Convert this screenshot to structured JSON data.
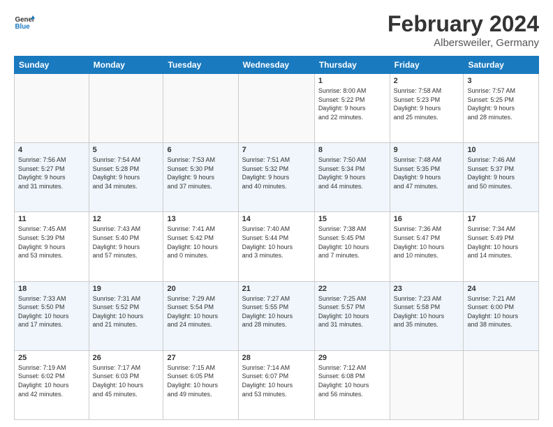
{
  "header": {
    "logo_line1": "General",
    "logo_line2": "Blue",
    "month_year": "February 2024",
    "location": "Albersweiler, Germany"
  },
  "days_of_week": [
    "Sunday",
    "Monday",
    "Tuesday",
    "Wednesday",
    "Thursday",
    "Friday",
    "Saturday"
  ],
  "weeks": [
    [
      {
        "day": "",
        "info": ""
      },
      {
        "day": "",
        "info": ""
      },
      {
        "day": "",
        "info": ""
      },
      {
        "day": "",
        "info": ""
      },
      {
        "day": "1",
        "info": "Sunrise: 8:00 AM\nSunset: 5:22 PM\nDaylight: 9 hours\nand 22 minutes."
      },
      {
        "day": "2",
        "info": "Sunrise: 7:58 AM\nSunset: 5:23 PM\nDaylight: 9 hours\nand 25 minutes."
      },
      {
        "day": "3",
        "info": "Sunrise: 7:57 AM\nSunset: 5:25 PM\nDaylight: 9 hours\nand 28 minutes."
      }
    ],
    [
      {
        "day": "4",
        "info": "Sunrise: 7:56 AM\nSunset: 5:27 PM\nDaylight: 9 hours\nand 31 minutes."
      },
      {
        "day": "5",
        "info": "Sunrise: 7:54 AM\nSunset: 5:28 PM\nDaylight: 9 hours\nand 34 minutes."
      },
      {
        "day": "6",
        "info": "Sunrise: 7:53 AM\nSunset: 5:30 PM\nDaylight: 9 hours\nand 37 minutes."
      },
      {
        "day": "7",
        "info": "Sunrise: 7:51 AM\nSunset: 5:32 PM\nDaylight: 9 hours\nand 40 minutes."
      },
      {
        "day": "8",
        "info": "Sunrise: 7:50 AM\nSunset: 5:34 PM\nDaylight: 9 hours\nand 44 minutes."
      },
      {
        "day": "9",
        "info": "Sunrise: 7:48 AM\nSunset: 5:35 PM\nDaylight: 9 hours\nand 47 minutes."
      },
      {
        "day": "10",
        "info": "Sunrise: 7:46 AM\nSunset: 5:37 PM\nDaylight: 9 hours\nand 50 minutes."
      }
    ],
    [
      {
        "day": "11",
        "info": "Sunrise: 7:45 AM\nSunset: 5:39 PM\nDaylight: 9 hours\nand 53 minutes."
      },
      {
        "day": "12",
        "info": "Sunrise: 7:43 AM\nSunset: 5:40 PM\nDaylight: 9 hours\nand 57 minutes."
      },
      {
        "day": "13",
        "info": "Sunrise: 7:41 AM\nSunset: 5:42 PM\nDaylight: 10 hours\nand 0 minutes."
      },
      {
        "day": "14",
        "info": "Sunrise: 7:40 AM\nSunset: 5:44 PM\nDaylight: 10 hours\nand 3 minutes."
      },
      {
        "day": "15",
        "info": "Sunrise: 7:38 AM\nSunset: 5:45 PM\nDaylight: 10 hours\nand 7 minutes."
      },
      {
        "day": "16",
        "info": "Sunrise: 7:36 AM\nSunset: 5:47 PM\nDaylight: 10 hours\nand 10 minutes."
      },
      {
        "day": "17",
        "info": "Sunrise: 7:34 AM\nSunset: 5:49 PM\nDaylight: 10 hours\nand 14 minutes."
      }
    ],
    [
      {
        "day": "18",
        "info": "Sunrise: 7:33 AM\nSunset: 5:50 PM\nDaylight: 10 hours\nand 17 minutes."
      },
      {
        "day": "19",
        "info": "Sunrise: 7:31 AM\nSunset: 5:52 PM\nDaylight: 10 hours\nand 21 minutes."
      },
      {
        "day": "20",
        "info": "Sunrise: 7:29 AM\nSunset: 5:54 PM\nDaylight: 10 hours\nand 24 minutes."
      },
      {
        "day": "21",
        "info": "Sunrise: 7:27 AM\nSunset: 5:55 PM\nDaylight: 10 hours\nand 28 minutes."
      },
      {
        "day": "22",
        "info": "Sunrise: 7:25 AM\nSunset: 5:57 PM\nDaylight: 10 hours\nand 31 minutes."
      },
      {
        "day": "23",
        "info": "Sunrise: 7:23 AM\nSunset: 5:58 PM\nDaylight: 10 hours\nand 35 minutes."
      },
      {
        "day": "24",
        "info": "Sunrise: 7:21 AM\nSunset: 6:00 PM\nDaylight: 10 hours\nand 38 minutes."
      }
    ],
    [
      {
        "day": "25",
        "info": "Sunrise: 7:19 AM\nSunset: 6:02 PM\nDaylight: 10 hours\nand 42 minutes."
      },
      {
        "day": "26",
        "info": "Sunrise: 7:17 AM\nSunset: 6:03 PM\nDaylight: 10 hours\nand 45 minutes."
      },
      {
        "day": "27",
        "info": "Sunrise: 7:15 AM\nSunset: 6:05 PM\nDaylight: 10 hours\nand 49 minutes."
      },
      {
        "day": "28",
        "info": "Sunrise: 7:14 AM\nSunset: 6:07 PM\nDaylight: 10 hours\nand 53 minutes."
      },
      {
        "day": "29",
        "info": "Sunrise: 7:12 AM\nSunset: 6:08 PM\nDaylight: 10 hours\nand 56 minutes."
      },
      {
        "day": "",
        "info": ""
      },
      {
        "day": "",
        "info": ""
      }
    ]
  ]
}
